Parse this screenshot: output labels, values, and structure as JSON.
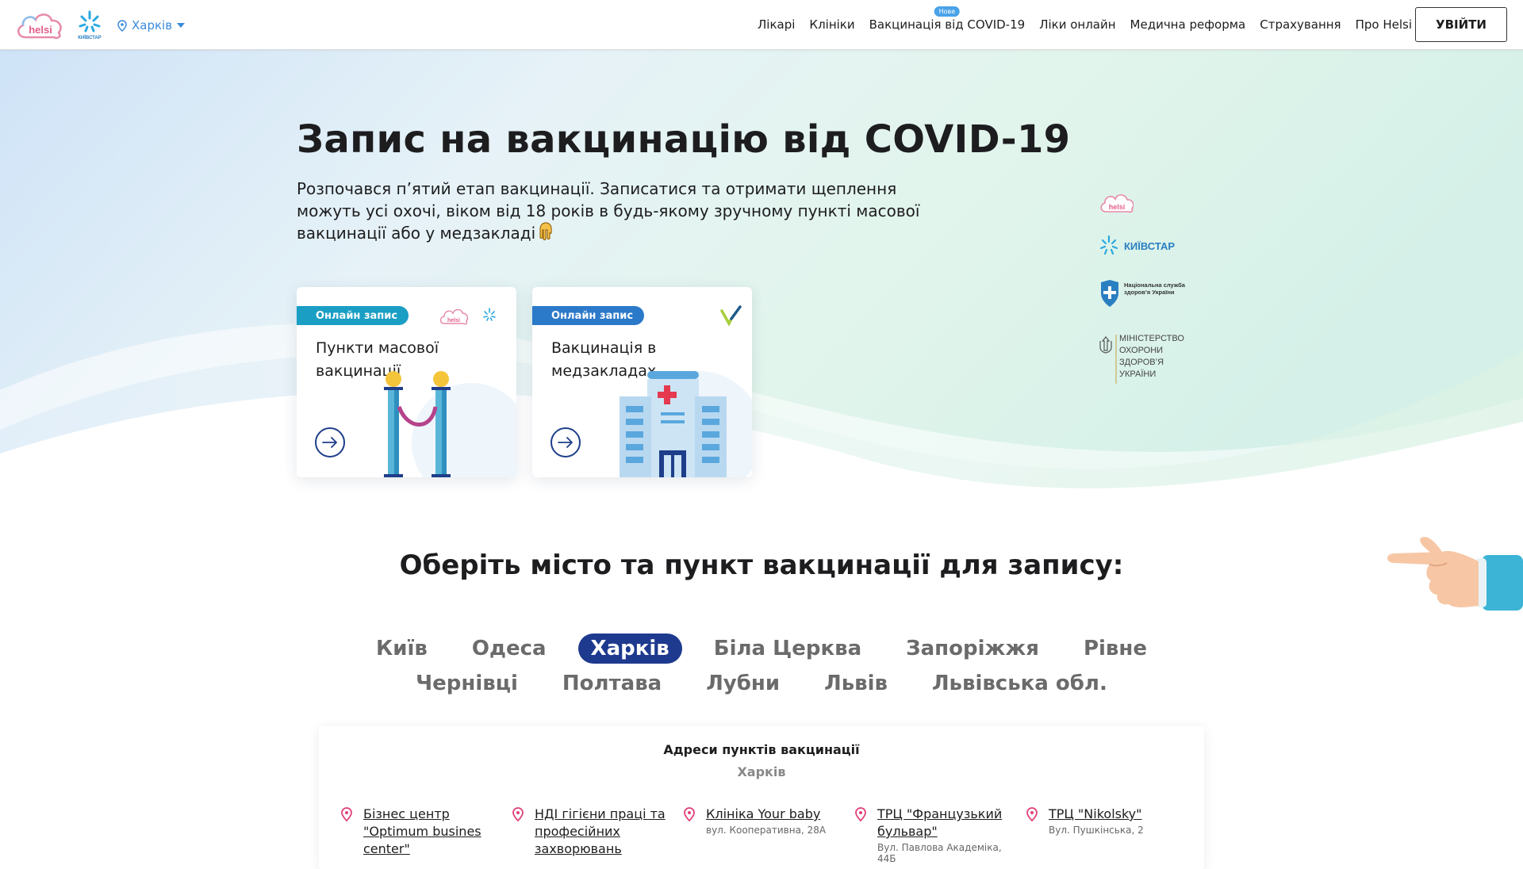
{
  "header": {
    "city": "Харків",
    "nav": [
      {
        "label": "Лікарі"
      },
      {
        "label": "Клініки"
      },
      {
        "label": "Вакцинація від COVID-19",
        "badge": "Нове"
      },
      {
        "label": "Ліки онлайн"
      },
      {
        "label": "Медична реформа"
      },
      {
        "label": "Страхування"
      },
      {
        "label": "Про Helsi"
      }
    ],
    "login_label": "УВІЙТИ"
  },
  "hero": {
    "title": "Запис на вакцинацію від COVID-19",
    "subtitle": "Розпочався п’ятий етап вакцинації. Записатися та отримати щеплення можуть усі охочі, віком від 18 років в будь-якому зручному пункті масової вакцинації або у медзакладі"
  },
  "cards": [
    {
      "badge": "Онлайн запис",
      "title": "Пункти масової вакцинації"
    },
    {
      "badge": "Онлайн запис",
      "title": "Вакцинація в медзакладах"
    }
  ],
  "partners": {
    "helsi": "helsi",
    "kyivstar": "КИЇВСТАР",
    "nszu": "Національна служба здоров’я України",
    "moz": [
      "МІНІСТЕРСТВО",
      "ОХОРОНИ",
      "ЗДОРОВ’Я",
      "УКРАЇНИ"
    ]
  },
  "logos": {
    "helsi": "helsi",
    "kyivstar": "КИЇВСТАР"
  },
  "cities_section": {
    "title": "Оберіть місто та пункт вакцинації для запису:",
    "rows": [
      [
        "Київ",
        "Одеса",
        "Харків",
        "Біла Церква",
        "Запоріжжя",
        "Рівне"
      ],
      [
        "Чернівці",
        "Полтава",
        "Лубни",
        "Львів",
        "Львівська обл."
      ]
    ],
    "active": "Харків"
  },
  "addresses": {
    "title": "Адреси пунктів вакцинації",
    "city": "Харків",
    "items": [
      {
        "name": "Бізнес центр \"Optimum busines center\"",
        "street": ""
      },
      {
        "name": "НДІ гігієни праці та професійних захворювань",
        "street": ""
      },
      {
        "name": "Клініка Your baby",
        "street": "вул. Кооперативна, 28А"
      },
      {
        "name": "ТРЦ \"Французький бульвар\"",
        "street": "Вул. Павлова Академіка, 44Б"
      },
      {
        "name": "ТРЦ \"Nikolsky\"",
        "street": "Вул. Пушкінська, 2"
      }
    ]
  },
  "colors": {
    "accent": "#1e3a8f",
    "link": "#3a8ad9",
    "badge_mass": "#1a9ec4",
    "badge_clinic": "#2b79c9",
    "pin": "#e0417a"
  }
}
